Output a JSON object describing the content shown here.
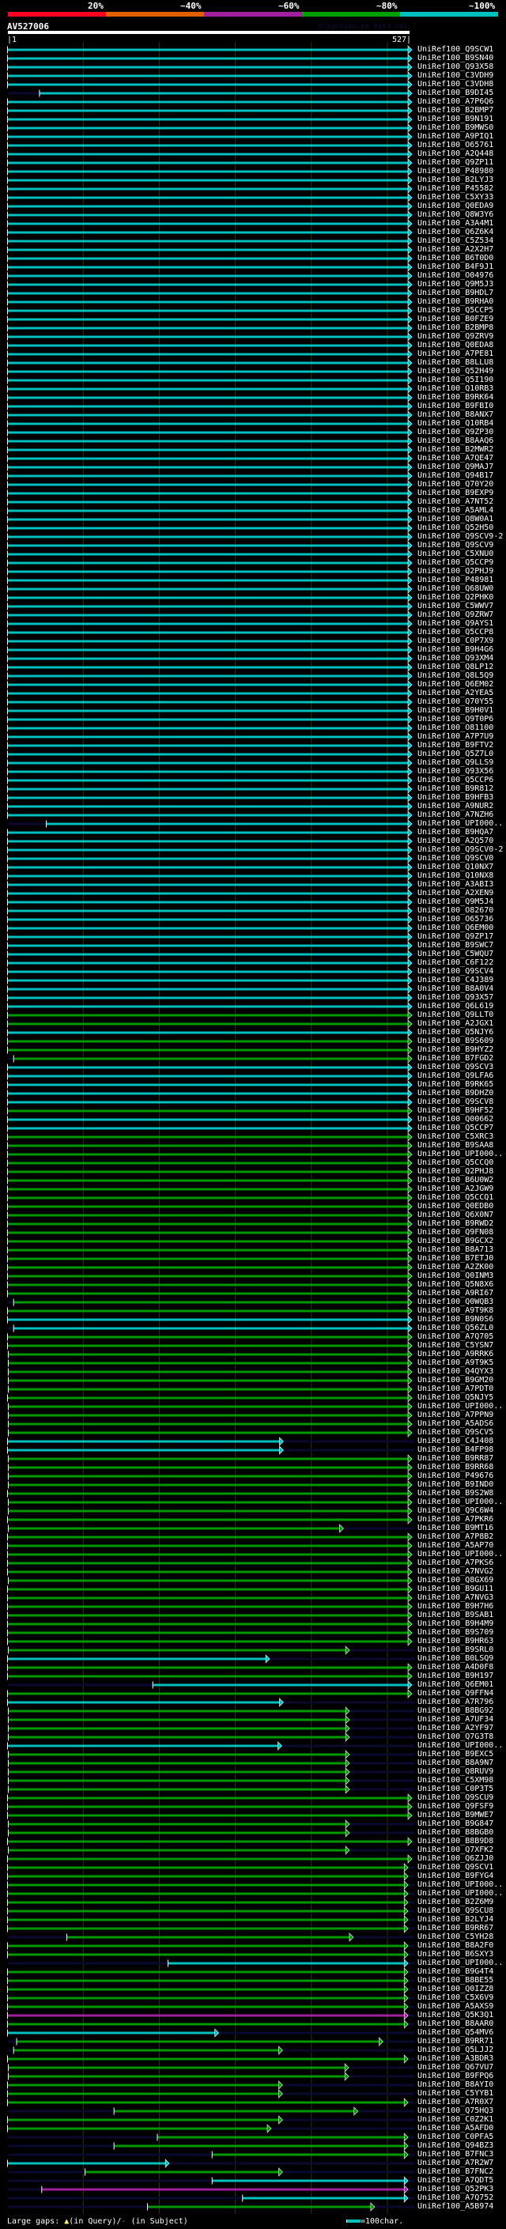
{
  "legend": {
    "labels": [
      "20%",
      "~40%",
      "~60%",
      "~80%",
      "~100%"
    ],
    "colors": [
      "#ff0020",
      "#e06000",
      "#a020a0",
      "#00a000",
      "#00c0c0"
    ]
  },
  "query": {
    "title": "AV527006",
    "start_label": "|1",
    "end_label": "527|",
    "length": 527
  },
  "watermark": "AlignView.pm Beta rel.7",
  "colors": {
    "c": "#00c0c0",
    "g": "#009900",
    "m": "#a020a0",
    "subject_line": "#0a0a30",
    "grid": "#333300"
  },
  "footer": {
    "gaps_label": "Large gaps: ",
    "query_gap": "▲",
    "query_text": "(in Query)/",
    "subject_gap": "-",
    "subject_text": " (in Subject)",
    "scale_label": "=100char."
  },
  "rows": [
    [
      "UniRef100_Q9SCW1",
      "c",
      1,
      527
    ],
    [
      "UniRef100_B9SN40",
      "c",
      1,
      527
    ],
    [
      "UniRef100_Q93X58",
      "c",
      1,
      527
    ],
    [
      "UniRef100_C3VDH9",
      "c",
      1,
      527
    ],
    [
      "UniRef100_C3VDH8",
      "c",
      1,
      527
    ],
    [
      "UniRef100_B9DI45",
      "c",
      43,
      527
    ],
    [
      "UniRef100_A7P6Q6",
      "c",
      1,
      527
    ],
    [
      "UniRef100_B2BMP7",
      "c",
      1,
      527
    ],
    [
      "UniRef100_B9N191",
      "c",
      1,
      527
    ],
    [
      "UniRef100_B9MWS0",
      "c",
      1,
      527
    ],
    [
      "UniRef100_A9PIQ1",
      "c",
      1,
      527
    ],
    [
      "UniRef100_O65761",
      "c",
      1,
      527
    ],
    [
      "UniRef100_A2Q448",
      "c",
      1,
      527
    ],
    [
      "UniRef100_Q9ZP11",
      "c",
      1,
      527
    ],
    [
      "UniRef100_P48980",
      "c",
      1,
      527
    ],
    [
      "UniRef100_B2LYJ3",
      "c",
      1,
      527
    ],
    [
      "UniRef100_P45582",
      "c",
      1,
      527
    ],
    [
      "UniRef100_C5XY33",
      "c",
      1,
      527
    ],
    [
      "UniRef100_Q0EDA9",
      "c",
      1,
      527
    ],
    [
      "UniRef100_Q8W3Y6",
      "c",
      1,
      527
    ],
    [
      "UniRef100_A3A4M1",
      "c",
      1,
      527
    ],
    [
      "UniRef100_Q6Z6K4",
      "c",
      1,
      527
    ],
    [
      "UniRef100_C5Z534",
      "c",
      1,
      527
    ],
    [
      "UniRef100_A2X2H7",
      "c",
      1,
      527
    ],
    [
      "UniRef100_B6T0D0",
      "c",
      1,
      527
    ],
    [
      "UniRef100_B4F9J1",
      "c",
      1,
      527
    ],
    [
      "UniRef100_O04976",
      "c",
      1,
      527
    ],
    [
      "UniRef100_Q9M5J3",
      "c",
      1,
      527
    ],
    [
      "UniRef100_B9HDL7",
      "c",
      1,
      527
    ],
    [
      "UniRef100_B9RHA0",
      "c",
      1,
      527
    ],
    [
      "UniRef100_Q5CCP5",
      "c",
      1,
      527
    ],
    [
      "UniRef100_B0FZE9",
      "c",
      1,
      527
    ],
    [
      "UniRef100_B2BMP8",
      "c",
      1,
      527
    ],
    [
      "UniRef100_Q9ZRV9",
      "c",
      1,
      527
    ],
    [
      "UniRef100_Q0EDA8",
      "c",
      1,
      527
    ],
    [
      "UniRef100_A7PE81",
      "c",
      1,
      527
    ],
    [
      "UniRef100_B8LLU8",
      "c",
      1,
      527
    ],
    [
      "UniRef100_Q52H49",
      "c",
      1,
      527
    ],
    [
      "UniRef100_Q5I190",
      "c",
      1,
      527
    ],
    [
      "UniRef100_Q10RB3",
      "c",
      1,
      527
    ],
    [
      "UniRef100_B9RK64",
      "c",
      1,
      527
    ],
    [
      "UniRef100_B9FBI0",
      "c",
      1,
      527
    ],
    [
      "UniRef100_B8ANX7",
      "c",
      1,
      527
    ],
    [
      "UniRef100_Q10RB4",
      "c",
      1,
      527
    ],
    [
      "UniRef100_Q9ZP30",
      "c",
      1,
      527
    ],
    [
      "UniRef100_B8AAQ6",
      "c",
      1,
      527
    ],
    [
      "UniRef100_B2MWR2",
      "c",
      1,
      527
    ],
    [
      "UniRef100_A7QE47",
      "c",
      1,
      527
    ],
    [
      "UniRef100_Q9MAJ7",
      "c",
      1,
      527
    ],
    [
      "UniRef100_Q94B17",
      "c",
      1,
      527
    ],
    [
      "UniRef100_Q70Y20",
      "c",
      1,
      527
    ],
    [
      "UniRef100_B9EXP9",
      "c",
      1,
      527
    ],
    [
      "UniRef100_A7NT52",
      "c",
      1,
      527
    ],
    [
      "UniRef100_A5AML4",
      "c",
      1,
      527
    ],
    [
      "UniRef100_Q8W0A1",
      "c",
      1,
      527
    ],
    [
      "UniRef100_Q52H50",
      "c",
      1,
      527
    ],
    [
      "UniRef100_Q9SCV9-2",
      "c",
      1,
      527
    ],
    [
      "UniRef100_Q9SCV9",
      "c",
      1,
      527
    ],
    [
      "UniRef100_C5XNU0",
      "c",
      1,
      527
    ],
    [
      "UniRef100_Q5CCP9",
      "c",
      1,
      527
    ],
    [
      "UniRef100_Q2PHJ9",
      "c",
      1,
      527
    ],
    [
      "UniRef100_P48981",
      "c",
      1,
      527
    ],
    [
      "UniRef100_Q68UW0",
      "c",
      1,
      527
    ],
    [
      "UniRef100_Q2PHK0",
      "c",
      1,
      527
    ],
    [
      "UniRef100_C5WWV7",
      "c",
      1,
      527
    ],
    [
      "UniRef100_Q9ZRW7",
      "c",
      1,
      527
    ],
    [
      "UniRef100_Q9AYS1",
      "c",
      1,
      527
    ],
    [
      "UniRef100_Q5CCP8",
      "c",
      1,
      527
    ],
    [
      "UniRef100_C0P7X9",
      "c",
      1,
      527
    ],
    [
      "UniRef100_B9H4G6",
      "c",
      1,
      527
    ],
    [
      "UniRef100_Q93XM4",
      "c",
      1,
      527
    ],
    [
      "UniRef100_Q8LP12",
      "c",
      1,
      527
    ],
    [
      "UniRef100_Q8L5Q9",
      "c",
      1,
      527
    ],
    [
      "UniRef100_Q6EM02",
      "c",
      1,
      527
    ],
    [
      "UniRef100_A2YEA5",
      "c",
      1,
      527
    ],
    [
      "UniRef100_Q70Y55",
      "c",
      1,
      527
    ],
    [
      "UniRef100_B9H0V1",
      "c",
      1,
      527
    ],
    [
      "UniRef100_Q9T0P6",
      "c",
      1,
      527
    ],
    [
      "UniRef100_O81100",
      "c",
      1,
      527
    ],
    [
      "UniRef100_A7P7U9",
      "c",
      1,
      527
    ],
    [
      "UniRef100_B9FTV2",
      "c",
      1,
      527
    ],
    [
      "UniRef100_Q5Z7L0",
      "c",
      1,
      527
    ],
    [
      "UniRef100_Q9LLS9",
      "c",
      1,
      527
    ],
    [
      "UniRef100_Q93X56",
      "c",
      1,
      527
    ],
    [
      "UniRef100_Q5CCP6",
      "c",
      1,
      527
    ],
    [
      "UniRef100_B9R812",
      "c",
      1,
      527
    ],
    [
      "UniRef100_B9HFB3",
      "c",
      1,
      527
    ],
    [
      "UniRef100_A9NUR2",
      "c",
      1,
      527
    ],
    [
      "UniRef100_A7NZH6",
      "c",
      1,
      527
    ],
    [
      "UniRef100_UPI000..",
      "c",
      52,
      527
    ],
    [
      "UniRef100_B9HQA7",
      "c",
      1,
      527
    ],
    [
      "UniRef100_A2Q570",
      "c",
      1,
      527
    ],
    [
      "UniRef100_Q9SCV0-2",
      "c",
      1,
      527
    ],
    [
      "UniRef100_Q9SCV0",
      "c",
      1,
      527
    ],
    [
      "UniRef100_Q10NX7",
      "c",
      1,
      527
    ],
    [
      "UniRef100_Q10NX8",
      "c",
      1,
      527
    ],
    [
      "UniRef100_A3ABI3",
      "c",
      1,
      527
    ],
    [
      "UniRef100_A2XEN9",
      "c",
      1,
      527
    ],
    [
      "UniRef100_Q9M5J4",
      "c",
      1,
      527
    ],
    [
      "UniRef100_O82670",
      "c",
      1,
      527
    ],
    [
      "UniRef100_O65736",
      "c",
      1,
      527
    ],
    [
      "UniRef100_Q6EM00",
      "c",
      1,
      527
    ],
    [
      "UniRef100_Q9ZP17",
      "c",
      1,
      527
    ],
    [
      "UniRef100_B9SWC7",
      "c",
      1,
      527
    ],
    [
      "UniRef100_C5WQU7",
      "c",
      1,
      527
    ],
    [
      "UniRef100_C6F122",
      "c",
      1,
      527
    ],
    [
      "UniRef100_Q9SCV4",
      "c",
      1,
      527
    ],
    [
      "UniRef100_C4J389",
      "c",
      1,
      527
    ],
    [
      "UniRef100_B8A0V4",
      "c",
      1,
      527
    ],
    [
      "UniRef100_Q93X57",
      "c",
      1,
      527
    ],
    [
      "UniRef100_Q6L619",
      "c",
      1,
      527
    ],
    [
      "UniRef100_Q9LLT0",
      "g",
      1,
      527
    ],
    [
      "UniRef100_A2JGX1",
      "g",
      1,
      527
    ],
    [
      "UniRef100_Q5NJY6",
      "c",
      1,
      527
    ],
    [
      "UniRef100_B9S609",
      "g",
      1,
      527
    ],
    [
      "UniRef100_B9HYZ2",
      "g",
      1,
      527
    ],
    [
      "UniRef100_B7FGD2",
      "g",
      9,
      527
    ],
    [
      "UniRef100_Q9SCV3",
      "c",
      1,
      527
    ],
    [
      "UniRef100_Q9LFA6",
      "c",
      1,
      527
    ],
    [
      "UniRef100_B9RK65",
      "c",
      1,
      527
    ],
    [
      "UniRef100_B9DHZ0",
      "c",
      1,
      527
    ],
    [
      "UniRef100_Q9SCV8",
      "c",
      1,
      527
    ],
    [
      "UniRef100_B9HF52",
      "g",
      1,
      527
    ],
    [
      "UniRef100_Q00662",
      "c",
      1,
      527
    ],
    [
      "UniRef100_Q5CCP7",
      "c",
      1,
      527
    ],
    [
      "UniRef100_C5XRC3",
      "g",
      1,
      527
    ],
    [
      "UniRef100_B9SAA8",
      "g",
      1,
      527
    ],
    [
      "UniRef100_UPI000..",
      "g",
      1,
      527
    ],
    [
      "UniRef100_Q5CCQ0",
      "g",
      1,
      527
    ],
    [
      "UniRef100_Q2PHJ8",
      "g",
      1,
      527
    ],
    [
      "UniRef100_B6U0W2",
      "g",
      1,
      527
    ],
    [
      "UniRef100_A2JGW9",
      "g",
      1,
      527
    ],
    [
      "UniRef100_Q5CCQ1",
      "g",
      1,
      527
    ],
    [
      "UniRef100_Q0EDB0",
      "g",
      1,
      527
    ],
    [
      "UniRef100_Q6X0N7",
      "g",
      1,
      527
    ],
    [
      "UniRef100_B9RWD2",
      "g",
      1,
      527
    ],
    [
      "UniRef100_Q9FN08",
      "g",
      1,
      527
    ],
    [
      "UniRef100_B9GCX2",
      "g",
      1,
      527
    ],
    [
      "UniRef100_B8A713",
      "g",
      1,
      527
    ],
    [
      "UniRef100_B7ETJ0",
      "g",
      1,
      527
    ],
    [
      "UniRef100_A2ZK00",
      "g",
      1,
      527
    ],
    [
      "UniRef100_Q0INM3",
      "g",
      1,
      527
    ],
    [
      "UniRef100_Q5N8X6",
      "g",
      1,
      527
    ],
    [
      "UniRef100_A9RI67",
      "g",
      1,
      527
    ],
    [
      "UniRef100_Q0WQB3",
      "g",
      9,
      527
    ],
    [
      "UniRef100_A9T9K8",
      "g",
      1,
      527
    ],
    [
      "UniRef100_B9N0S6",
      "c",
      1,
      527
    ],
    [
      "UniRef100_Q56ZL0",
      "c",
      9,
      527
    ],
    [
      "UniRef100_A7Q705",
      "g",
      1,
      527
    ],
    [
      "UniRef100_C5YSN7",
      "g",
      1,
      527
    ],
    [
      "UniRef100_A9RRK6",
      "g",
      2,
      527
    ],
    [
      "UniRef100_A9T9K5",
      "g",
      2,
      527
    ],
    [
      "UniRef100_Q4QYX3",
      "g",
      2,
      527
    ],
    [
      "UniRef100_B9GM20",
      "g",
      2,
      527
    ],
    [
      "UniRef100_A7PDT0",
      "g",
      2,
      527
    ],
    [
      "UniRef100_Q5NJY5",
      "g",
      1,
      527
    ],
    [
      "UniRef100_UPI000..",
      "g",
      2,
      527
    ],
    [
      "UniRef100_A7PPN9",
      "g",
      2,
      527
    ],
    [
      "UniRef100_A5ADS6",
      "g",
      2,
      527
    ],
    [
      "UniRef100_Q9SCV5",
      "g",
      2,
      527
    ],
    [
      "UniRef100_C4J408",
      "c",
      1,
      358
    ],
    [
      "UniRef100_B4FP98",
      "c",
      1,
      358
    ],
    [
      "UniRef100_B9RR87",
      "g",
      2,
      527
    ],
    [
      "UniRef100_B9RR68",
      "g",
      2,
      527
    ],
    [
      "UniRef100_P49676",
      "g",
      2,
      527
    ],
    [
      "UniRef100_B9IND0",
      "g",
      2,
      527
    ],
    [
      "UniRef100_B9S2W8",
      "g",
      1,
      527
    ],
    [
      "UniRef100_UPI000..",
      "g",
      2,
      527
    ],
    [
      "UniRef100_Q9C6W4",
      "g",
      2,
      527
    ],
    [
      "UniRef100_A7PKR6",
      "g",
      1,
      527
    ],
    [
      "UniRef100_B9MT16",
      "g",
      2,
      437
    ],
    [
      "UniRef100_A7P8B2",
      "g",
      1,
      527
    ],
    [
      "UniRef100_A5AP70",
      "g",
      1,
      527
    ],
    [
      "UniRef100_UPI000..",
      "g",
      1,
      527
    ],
    [
      "UniRef100_A7PKS6",
      "g",
      1,
      527
    ],
    [
      "UniRef100_A7NVG2",
      "g",
      1,
      527
    ],
    [
      "UniRef100_Q8GX69",
      "g",
      2,
      527
    ],
    [
      "UniRef100_B9GU11",
      "g",
      1,
      527
    ],
    [
      "UniRef100_A7NVG3",
      "g",
      1,
      527
    ],
    [
      "UniRef100_B9H7H6",
      "g",
      1,
      527
    ],
    [
      "UniRef100_B9SAB1",
      "g",
      1,
      527
    ],
    [
      "UniRef100_B9H4M9",
      "g",
      1,
      527
    ],
    [
      "UniRef100_B9S709",
      "g",
      1,
      527
    ],
    [
      "UniRef100_B9HR63",
      "g",
      1,
      527
    ],
    [
      "UniRef100_B9SRL0",
      "g",
      2,
      445
    ],
    [
      "UniRef100_B0LSQ9",
      "c",
      1,
      340
    ],
    [
      "UniRef100_A4D0F8",
      "g",
      1,
      527
    ],
    [
      "UniRef100_B9H197",
      "g",
      1,
      527
    ],
    [
      "UniRef100_Q6EM01",
      "c",
      192,
      527
    ],
    [
      "UniRef100_Q9FFN4",
      "g",
      1,
      527
    ],
    [
      "UniRef100_A7R796",
      "c",
      1,
      358
    ],
    [
      "UniRef100_B8BG92",
      "g",
      2,
      445
    ],
    [
      "UniRef100_A7UF34",
      "g",
      2,
      445
    ],
    [
      "UniRef100_A2YF97",
      "g",
      2,
      445
    ],
    [
      "UniRef100_Q7G3T8",
      "g",
      2,
      445
    ],
    [
      "UniRef100_UPI000..",
      "c",
      1,
      356
    ],
    [
      "UniRef100_B9EXC5",
      "g",
      2,
      445
    ],
    [
      "UniRef100_B8A9N7",
      "g",
      2,
      445
    ],
    [
      "UniRef100_Q8RUV9",
      "g",
      2,
      445
    ],
    [
      "UniRef100_C5XM98",
      "g",
      2,
      445
    ],
    [
      "UniRef100_C0P3T5",
      "g",
      2,
      445
    ],
    [
      "UniRef100_Q9SCU9",
      "g",
      1,
      527
    ],
    [
      "UniRef100_Q9FSF9",
      "g",
      1,
      527
    ],
    [
      "UniRef100_B9MWE7",
      "g",
      1,
      527
    ],
    [
      "UniRef100_B9G847",
      "g",
      2,
      445
    ],
    [
      "UniRef100_B8BGB0",
      "g",
      2,
      445
    ],
    [
      "UniRef100_B8B9D8",
      "g",
      1,
      527
    ],
    [
      "UniRef100_Q7XFK2",
      "g",
      2,
      445
    ],
    [
      "UniRef100_Q6ZJJ0",
      "g",
      1,
      527
    ],
    [
      "UniRef100_Q9SCV1",
      "g",
      1,
      522
    ],
    [
      "UniRef100_B9FYG4",
      "g",
      1,
      522
    ],
    [
      "UniRef100_UPI000..",
      "g",
      1,
      522
    ],
    [
      "UniRef100_UPI000..",
      "g",
      1,
      522
    ],
    [
      "UniRef100_B2Z6M9",
      "g",
      1,
      522
    ],
    [
      "UniRef100_Q9SCU8",
      "g",
      1,
      522
    ],
    [
      "UniRef100_B2LYJ4",
      "g",
      1,
      522
    ],
    [
      "UniRef100_B9RR67",
      "g",
      1,
      522
    ],
    [
      "UniRef100_C5YH28",
      "g",
      79,
      450
    ],
    [
      "UniRef100_B8A2F0",
      "g",
      1,
      522
    ],
    [
      "UniRef100_B6SXY3",
      "g",
      1,
      522
    ],
    [
      "UniRef100_UPI000..",
      "c",
      212,
      522
    ],
    [
      "UniRef100_B9G4T4",
      "g",
      1,
      522
    ],
    [
      "UniRef100_B8BE55",
      "g",
      1,
      522
    ],
    [
      "UniRef100_Q0IZZ8",
      "g",
      1,
      522
    ],
    [
      "UniRef100_C5X6V9",
      "g",
      1,
      522
    ],
    [
      "UniRef100_A5AXS9",
      "g",
      1,
      522
    ],
    [
      "UniRef100_Q5K3Q1",
      "m",
      1,
      522
    ],
    [
      "UniRef100_B8AAR0",
      "g",
      1,
      522
    ],
    [
      "UniRef100_Q54MV6",
      "c",
      1,
      273
    ],
    [
      "UniRef100_B9RR71",
      "g",
      13,
      489
    ],
    [
      "UniRef100_Q5LJJ2",
      "g",
      9,
      357
    ],
    [
      "UniRef100_A3BDR3",
      "g",
      1,
      522
    ],
    [
      "UniRef100_Q67VU7",
      "g",
      2,
      444
    ],
    [
      "UniRef100_B9FPQ6",
      "g",
      2,
      444
    ],
    [
      "UniRef100_B8AYI0",
      "g",
      1,
      357
    ],
    [
      "UniRef100_C5YYB1",
      "g",
      1,
      357
    ],
    [
      "UniRef100_A7R0X7",
      "g",
      1,
      522
    ],
    [
      "UniRef100_Q75HQ3",
      "g",
      141,
      456
    ],
    [
      "UniRef100_C0Z2K1",
      "g",
      1,
      357
    ],
    [
      "UniRef100_A5AFD0",
      "g",
      1,
      342
    ],
    [
      "UniRef100_C0PFA5",
      "g",
      198,
      522
    ],
    [
      "UniRef100_Q94BZ3",
      "g",
      141,
      522
    ],
    [
      "UniRef100_B7FNC3",
      "g",
      270,
      522
    ],
    [
      "UniRef100_A7R2W7",
      "c",
      1,
      208
    ],
    [
      "UniRef100_B7FNC2",
      "g",
      103,
      357
    ],
    [
      "UniRef100_A7QDT5",
      "c",
      270,
      522
    ],
    [
      "UniRef100_Q52PK3",
      "m",
      46,
      522
    ],
    [
      "UniRef100_A7Q752",
      "c",
      310,
      522
    ],
    [
      "UniRef100_A5B974",
      "m",
      70,
      522
    ]
  ],
  "tail_row": [
    "UniRef100_A5B974_end",
    "g",
    185,
    478
  ]
}
